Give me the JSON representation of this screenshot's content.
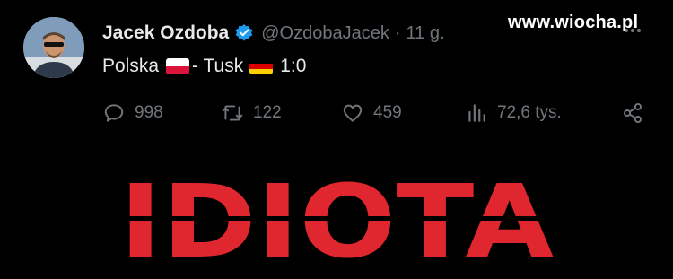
{
  "watermark": "www.wiocha.pl",
  "tweet": {
    "author_name": "Jacek Ozdoba",
    "handle": "@OzdobaJacek",
    "separator": "·",
    "time": "11 g.",
    "verified": true,
    "text_before": "Polska",
    "text_middle": "- Tusk",
    "text_after": "1:0",
    "flags": [
      "flag-poland",
      "flag-germany"
    ],
    "stats": {
      "replies": "998",
      "reposts": "122",
      "likes": "459",
      "views": "72,6 tys."
    }
  },
  "image_text": "IDIOTA",
  "colors": {
    "background": "#000000",
    "text": "#e7e9ea",
    "muted": "#71767b",
    "verified": "#1d9bf0",
    "image_text": "#e0262e"
  }
}
